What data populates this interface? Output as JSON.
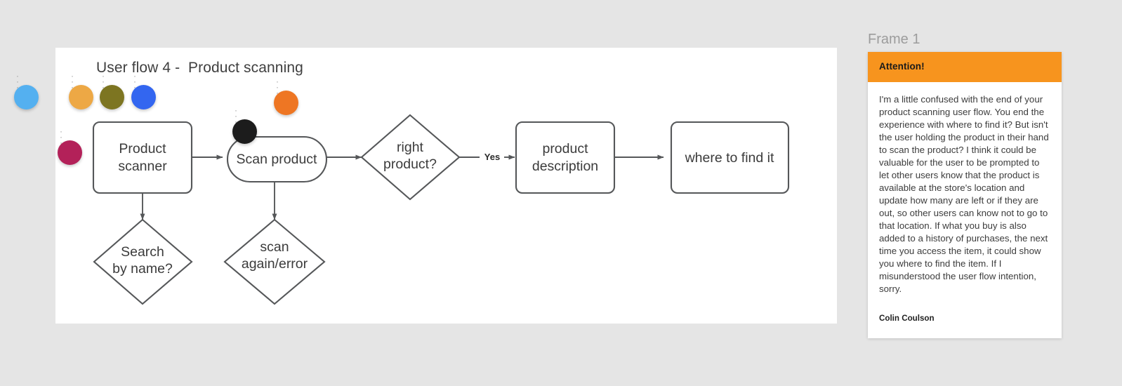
{
  "canvas": {
    "title": "User flow 4 -  Product scanning",
    "background_color": "#ffffff",
    "page_background_color": "#e5e5e5"
  },
  "flow": {
    "nodes": [
      {
        "id": "product-scanner",
        "label_lines": [
          "Product",
          "scanner"
        ],
        "shape": "rect"
      },
      {
        "id": "scan-product",
        "label_lines": [
          "Scan product"
        ],
        "shape": "pill"
      },
      {
        "id": "right-product",
        "label_lines": [
          "right",
          "product?"
        ],
        "shape": "diamond"
      },
      {
        "id": "product-description",
        "label_lines": [
          "product",
          "description"
        ],
        "shape": "rect"
      },
      {
        "id": "where-to-find-it",
        "label_lines": [
          "where to find it"
        ],
        "shape": "rect"
      },
      {
        "id": "search-by-name",
        "label_lines": [
          "Search",
          "by name?"
        ],
        "shape": "diamond"
      },
      {
        "id": "scan-again-error",
        "label_lines": [
          "scan",
          "again/error"
        ],
        "shape": "diamond"
      }
    ],
    "edge_labels": {
      "yes": "Yes"
    },
    "stroke_color": "#555759",
    "text_color": "#3b3b3b"
  },
  "cursors": [
    {
      "name": "cursor-blue",
      "color": "#54b0f0",
      "dots": "· · ·"
    },
    {
      "name": "cursor-amber",
      "color": "#eda845",
      "dots": "· · ·"
    },
    {
      "name": "cursor-olive",
      "color": "#7d7521",
      "dots": "· · ·"
    },
    {
      "name": "cursor-indigo",
      "color": "#3366f0",
      "dots": "· · ·"
    },
    {
      "name": "cursor-orange",
      "color": "#ee7623",
      "dots": "· · ·"
    },
    {
      "name": "cursor-black",
      "color": "#1c1c1c",
      "dots": "· · ·"
    },
    {
      "name": "cursor-magenta",
      "color": "#b32159",
      "dots": "· · ·"
    }
  ],
  "comment": {
    "frame_label": "Frame 1",
    "header_title": "Attention!",
    "header_color": "#f7941e",
    "body_text": "I'm a little confused with the end of your product scanning user flow. You end the experience with where to find it? But isn't the user holding the product in their hand to scan the product? I think it could be valuable for the user to be prompted to let other users know that the product is available at the store's location and update how many are left or if they are out, so other users can know not to go to that location. If what you buy is also added to a history of purchases, the next time you access the item, it could show you where to find the item. If I misunderstood the user flow intention, sorry.",
    "author": "Colin Coulson"
  }
}
